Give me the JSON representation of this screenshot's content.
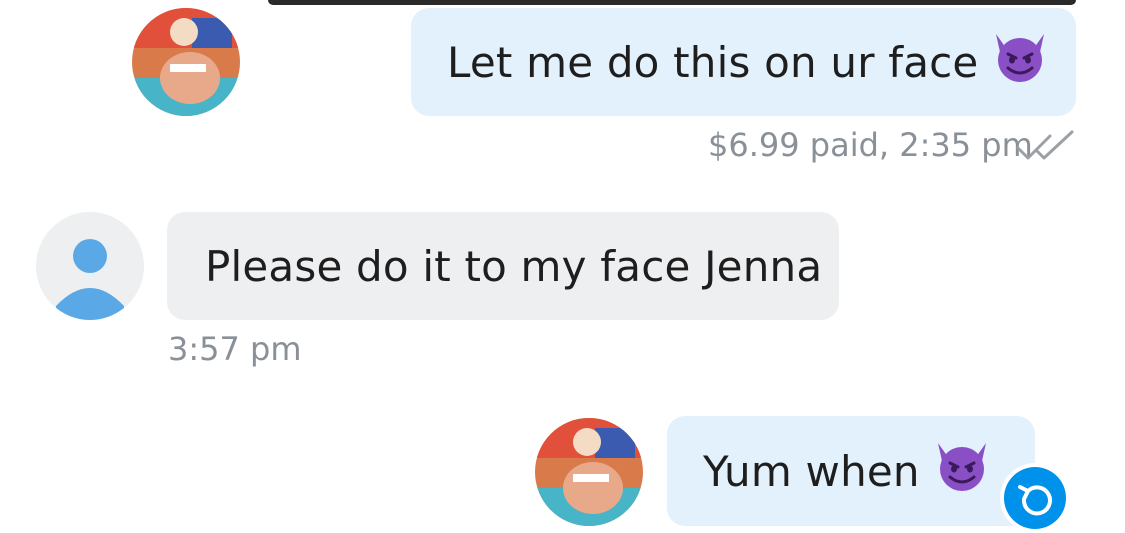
{
  "messages": [
    {
      "direction": "outgoing",
      "text": "Let me do this on ur face",
      "emoji": "smiling-imp",
      "meta": "$6.99 paid, 2:35 pm",
      "status_icon": "double-check-icon"
    },
    {
      "direction": "incoming",
      "text": "Please do it to my face Jenna",
      "meta": "3:57 pm"
    },
    {
      "direction": "outgoing",
      "text": "Yum when",
      "emoji": "smiling-imp",
      "action_icon": "undo-icon"
    }
  ],
  "colors": {
    "outgoing_bubble": "#e3f1fc",
    "incoming_bubble": "#eeeff0",
    "meta_text": "#8a9097",
    "accent": "#0091ea",
    "default_avatar": "#5aa9e6"
  }
}
